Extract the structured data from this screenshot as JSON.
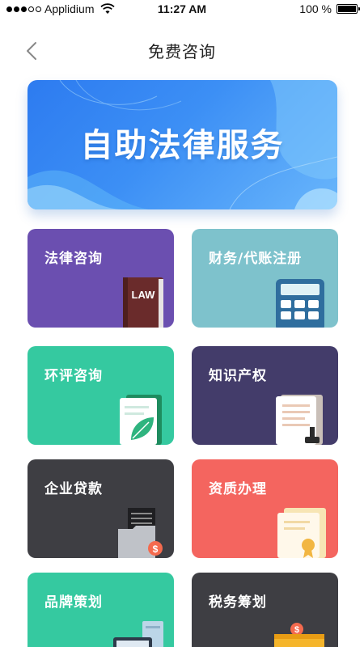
{
  "status_bar": {
    "carrier": "Applidium",
    "time": "11:27 AM",
    "battery": "100 %"
  },
  "nav": {
    "title": "免费咨询",
    "back_icon": "chevron-left-icon"
  },
  "banner": {
    "title": "自助法律服务"
  },
  "services": [
    {
      "label": "法律咨询",
      "color": "#6b4fb0",
      "icon": "law-book-icon",
      "icon_text": "LAW"
    },
    {
      "label": "财务/代账注册",
      "color": "#7ec2cc",
      "icon": "calculator-icon"
    },
    {
      "label": "环评咨询",
      "color": "#35c9a0",
      "icon": "leaf-document-icon"
    },
    {
      "label": "知识产权",
      "color": "#433c6a",
      "icon": "stamped-document-icon"
    },
    {
      "label": "企业贷款",
      "color": "#3e3e43",
      "icon": "folder-money-icon",
      "icon_text": "$"
    },
    {
      "label": "资质办理",
      "color": "#f4655f",
      "icon": "certificate-icon"
    },
    {
      "label": "品牌策划",
      "color": "#35c9a0",
      "icon": "computer-icon"
    },
    {
      "label": "税务筹划",
      "color": "#3e3e43",
      "icon": "wallet-money-icon",
      "icon_text": "$"
    }
  ]
}
